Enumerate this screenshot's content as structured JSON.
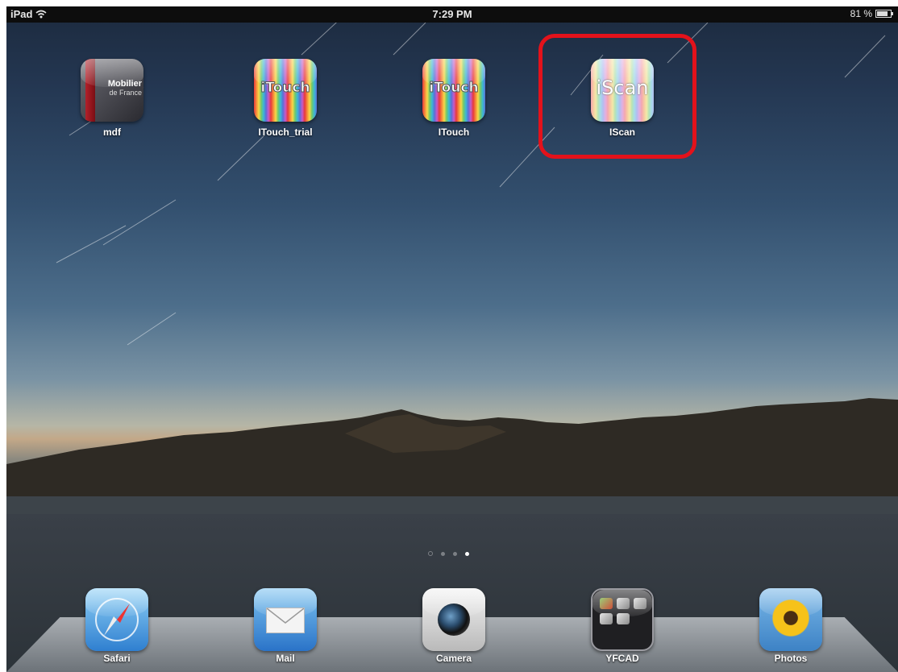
{
  "status_bar": {
    "device": "iPad",
    "time": "7:29 PM",
    "battery_percent": "81 %",
    "battery_level": 0.81
  },
  "home_apps": [
    {
      "label": "mdf",
      "icon": "mdf-icon",
      "icon_text": [
        "Mobilier",
        "de France"
      ]
    },
    {
      "label": "ITouch_trial",
      "icon": "itouch-icon",
      "icon_text": "iTouch"
    },
    {
      "label": "ITouch",
      "icon": "itouch-icon",
      "icon_text": "iTouch"
    },
    {
      "label": "IScan",
      "icon": "iscan-icon",
      "icon_text": "iScan",
      "highlighted": true
    }
  ],
  "page_indicator": {
    "pages": 3,
    "current": 3,
    "has_search_page": true
  },
  "dock": [
    {
      "label": "Safari",
      "icon": "safari-compass-icon"
    },
    {
      "label": "Mail",
      "icon": "mail-envelope-icon"
    },
    {
      "label": "Camera",
      "icon": "camera-lens-icon"
    },
    {
      "label": "YFCAD",
      "icon": "folder-icon"
    },
    {
      "label": "Photos",
      "icon": "sunflower-icon"
    }
  ],
  "colors": {
    "highlight": "#e3121b",
    "status_bar": "#0d0d0d",
    "label_text": "#ffffff"
  }
}
